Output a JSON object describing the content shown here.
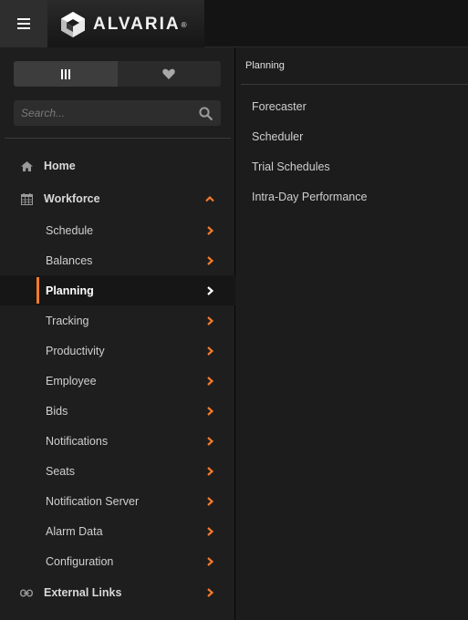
{
  "app": {
    "brand": "ALVARIA",
    "brand_mark": "®"
  },
  "header": {
    "menu_icon": "hamburger-icon"
  },
  "sidebar": {
    "toggle": {
      "left_icon": "columns-icon",
      "right_icon": "heart-icon"
    },
    "search": {
      "placeholder": "Search..."
    },
    "items": [
      {
        "label": "Home",
        "icon": "home-icon"
      },
      {
        "label": "Workforce",
        "icon": "calendar-icon"
      },
      {
        "label": "External Links",
        "icon": "link-icon"
      }
    ],
    "workforce_sub": [
      {
        "label": "Schedule"
      },
      {
        "label": "Balances"
      },
      {
        "label": "Planning"
      },
      {
        "label": "Tracking"
      },
      {
        "label": "Productivity"
      },
      {
        "label": "Employee"
      },
      {
        "label": "Bids"
      },
      {
        "label": "Notifications"
      },
      {
        "label": "Seats"
      },
      {
        "label": "Notification Server"
      },
      {
        "label": "Alarm Data"
      },
      {
        "label": "Configuration"
      }
    ],
    "active_sub": "Planning"
  },
  "panel": {
    "title": "Planning",
    "links": [
      "Forecaster",
      "Scheduler",
      "Trial Schedules",
      "Intra-Day Performance"
    ]
  },
  "colors": {
    "accent": "#f47a2a",
    "background": "#1c1c1c",
    "topbar": "#141414"
  }
}
